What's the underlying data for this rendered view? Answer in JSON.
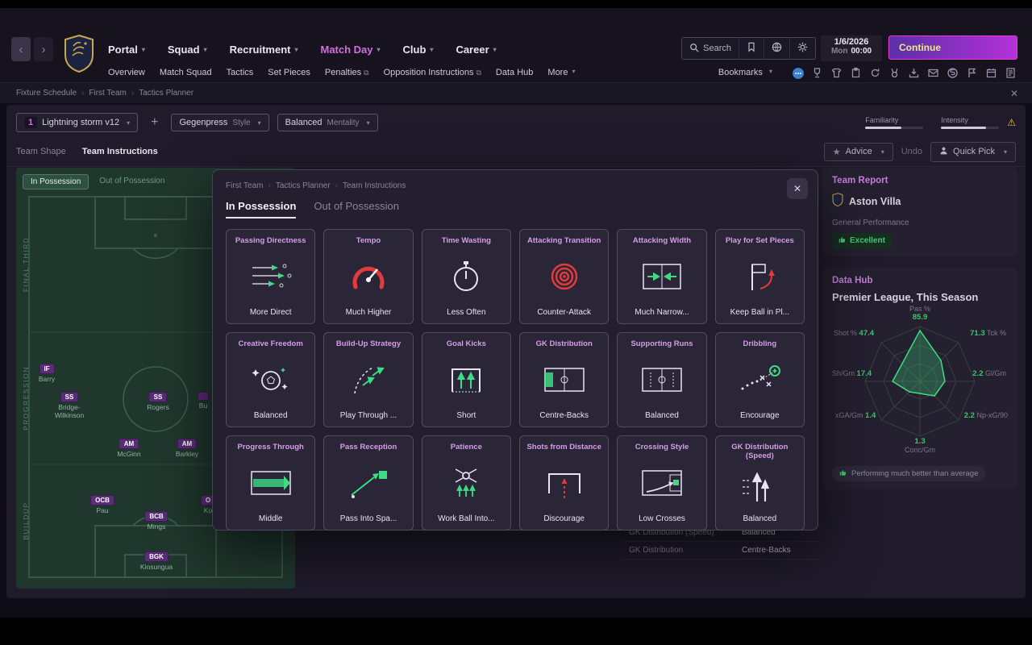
{
  "topbar": {
    "nav": [
      {
        "label": "Portal"
      },
      {
        "label": "Squad"
      },
      {
        "label": "Recruitment"
      },
      {
        "label": "Match Day"
      },
      {
        "label": "Club"
      },
      {
        "label": "Career"
      }
    ],
    "search_label": "Search",
    "date": "1/6/2026",
    "day": "Mon",
    "time": "00:00",
    "continue_label": "Continue"
  },
  "subnav": {
    "items": [
      {
        "label": "Overview"
      },
      {
        "label": "Match Squad"
      },
      {
        "label": "Tactics"
      },
      {
        "label": "Set Pieces"
      },
      {
        "label": "Penalties"
      },
      {
        "label": "Opposition Instructions"
      },
      {
        "label": "Data Hub"
      },
      {
        "label": "More"
      }
    ],
    "bookmarks_label": "Bookmarks"
  },
  "breadcrumb": {
    "items": [
      {
        "label": "Fixture Schedule"
      },
      {
        "label": "First Team"
      },
      {
        "label": "Tactics Planner"
      }
    ]
  },
  "tacticbar": {
    "slot_number": "1",
    "tactic_name": "Lightning storm v12",
    "style_value": "Gegenpress",
    "style_label": "Style",
    "mentality_value": "Balanced",
    "mentality_label": "Mentality",
    "familiarity_label": "Familiarity",
    "intensity_label": "Intensity"
  },
  "tabsbar": {
    "team_shape": "Team Shape",
    "team_instructions": "Team Instructions",
    "advice_label": "Advice",
    "undo_label": "Undo",
    "quickpick_label": "Quick Pick"
  },
  "pitch": {
    "tabs": [
      {
        "label": "In Possession"
      },
      {
        "label": "Out of Possession"
      }
    ],
    "zones": [
      {
        "label": "FINAL THIRD"
      },
      {
        "label": "PROGRESSION"
      },
      {
        "label": "BUILDUP"
      }
    ],
    "players": [
      {
        "pos": "IF",
        "name": "Barry"
      },
      {
        "pos": "SS",
        "name": "Bridge-Wilkinson"
      },
      {
        "pos": "SS",
        "name": "Rogers"
      },
      {
        "pos": "",
        "name": "Bu"
      },
      {
        "pos": "AM",
        "name": "McGinn"
      },
      {
        "pos": "AM",
        "name": "Barkley"
      },
      {
        "pos": "OCB",
        "name": "Pau"
      },
      {
        "pos": "BCB",
        "name": "Mings"
      },
      {
        "pos": "O",
        "name": "Ko"
      },
      {
        "pos": "BGK",
        "name": "Kiosungua"
      }
    ]
  },
  "modal": {
    "breadcrumb": [
      {
        "label": "First Team"
      },
      {
        "label": "Tactics Planner"
      },
      {
        "label": "Team Instructions"
      }
    ],
    "tabs": [
      {
        "label": "In Possession"
      },
      {
        "label": "Out of Possession"
      }
    ],
    "cards": [
      {
        "title": "Passing Directness",
        "value": "More Direct"
      },
      {
        "title": "Tempo",
        "value": "Much Higher"
      },
      {
        "title": "Time Wasting",
        "value": "Less Often"
      },
      {
        "title": "Attacking Transition",
        "value": "Counter-Attack"
      },
      {
        "title": "Attacking Width",
        "value": "Much Narrow..."
      },
      {
        "title": "Play for Set Pieces",
        "value": "Keep Ball in Pl..."
      },
      {
        "title": "Creative Freedom",
        "value": "Balanced"
      },
      {
        "title": "Build-Up Strategy",
        "value": "Play Through ..."
      },
      {
        "title": "Goal Kicks",
        "value": "Short"
      },
      {
        "title": "GK Distribution",
        "value": "Centre-Backs"
      },
      {
        "title": "Supporting Runs",
        "value": "Balanced"
      },
      {
        "title": "Dribbling",
        "value": "Encourage"
      },
      {
        "title": "Progress Through",
        "value": "Middle"
      },
      {
        "title": "Pass Reception",
        "value": "Pass Into Spa..."
      },
      {
        "title": "Patience",
        "value": "Work Ball Into..."
      },
      {
        "title": "Shots from Distance",
        "value": "Discourage"
      },
      {
        "title": "Crossing Style",
        "value": "Low Crosses"
      },
      {
        "title": "GK Distribution (Speed)",
        "value": "Balanced"
      }
    ]
  },
  "behind": {
    "rows": [
      {
        "label": "GK Distribution (Speed)",
        "value": "Balanced"
      },
      {
        "label": "GK Distribution",
        "value": "Centre-Backs"
      }
    ]
  },
  "sidebar": {
    "team_report": {
      "title": "Team Report",
      "team": "Aston Villa",
      "perf_label": "General Performance",
      "rating": "Excellent"
    },
    "data_hub": {
      "title": "Data Hub",
      "subtitle": "Premier League, This Season",
      "metrics": {
        "pas": {
          "label": "Pas %",
          "value": "85.9"
        },
        "shot": {
          "label": "Shot %",
          "value": "47.4"
        },
        "tck": {
          "label": "Tck %",
          "value": "71.3"
        },
        "sh": {
          "label": "Sh/Gm",
          "value": "17.4"
        },
        "gl": {
          "label": "Gl/Gm",
          "value": "2.2"
        },
        "xga": {
          "label": "xGA/Gm",
          "value": "1.4"
        },
        "npxg": {
          "label": "Np-xG/90",
          "value": "2.2"
        },
        "conc": {
          "label": "Conc/Gm",
          "value": "1.3"
        }
      },
      "badge": "Performing much better than average"
    }
  }
}
